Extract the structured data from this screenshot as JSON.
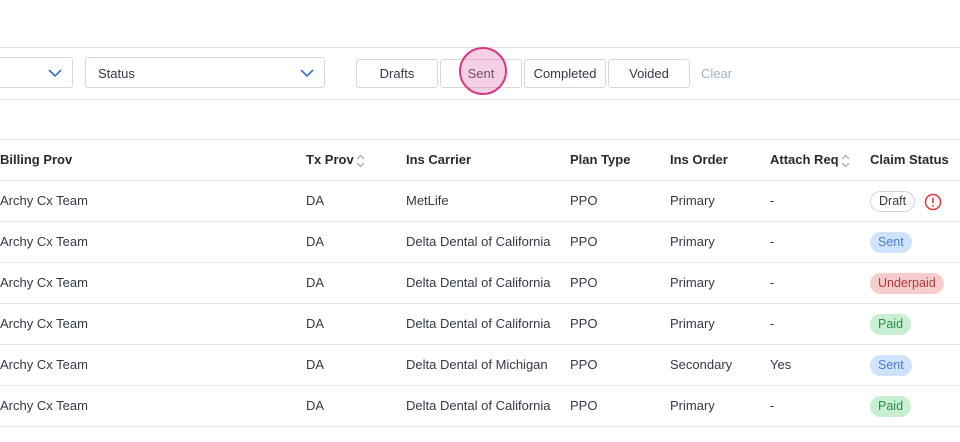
{
  "filters": {
    "left_select_value": "",
    "status_select_label": "Status",
    "chips": {
      "drafts": "Drafts",
      "sent": "Sent",
      "completed": "Completed",
      "voided": "Voided"
    },
    "clear_label": "Clear"
  },
  "table": {
    "headers": {
      "billing_prov": "Billing Prov",
      "tx_prov": "Tx Prov",
      "ins_carrier": "Ins Carrier",
      "plan_type": "Plan Type",
      "ins_order": "Ins Order",
      "attach_req": "Attach Req",
      "claim_status": "Claim Status"
    },
    "rows": [
      {
        "billing_prov": "Archy Cx Team",
        "tx_prov": "DA",
        "ins_carrier": "MetLife",
        "plan_type": "PPO",
        "ins_order": "Primary",
        "attach_req": "-",
        "claim_status": "Draft"
      },
      {
        "billing_prov": "Archy Cx Team",
        "tx_prov": "DA",
        "ins_carrier": "Delta Dental of California",
        "plan_type": "PPO",
        "ins_order": "Primary",
        "attach_req": "-",
        "claim_status": "Sent"
      },
      {
        "billing_prov": "Archy Cx Team",
        "tx_prov": "DA",
        "ins_carrier": "Delta Dental of California",
        "plan_type": "PPO",
        "ins_order": "Primary",
        "attach_req": "-",
        "claim_status": "Underpaid"
      },
      {
        "billing_prov": "Archy Cx Team",
        "tx_prov": "DA",
        "ins_carrier": "Delta Dental of California",
        "plan_type": "PPO",
        "ins_order": "Primary",
        "attach_req": "-",
        "claim_status": "Paid"
      },
      {
        "billing_prov": "Archy Cx Team",
        "tx_prov": "DA",
        "ins_carrier": "Delta Dental of Michigan",
        "plan_type": "PPO",
        "ins_order": "Secondary",
        "attach_req": "Yes",
        "claim_status": "Sent"
      },
      {
        "billing_prov": "Archy Cx Team",
        "tx_prov": "DA",
        "ins_carrier": "Delta Dental of California",
        "plan_type": "PPO",
        "ins_order": "Primary",
        "attach_req": "-",
        "claim_status": "Paid"
      }
    ]
  },
  "colors": {
    "accent_blue": "#4c7dcc",
    "alert_red": "#e03b3b",
    "click_ring": "#d63b87"
  },
  "icons": {
    "dropdown": "chevron-down-icon",
    "sort": "sort-icon",
    "alert": "alert-circle-icon"
  }
}
